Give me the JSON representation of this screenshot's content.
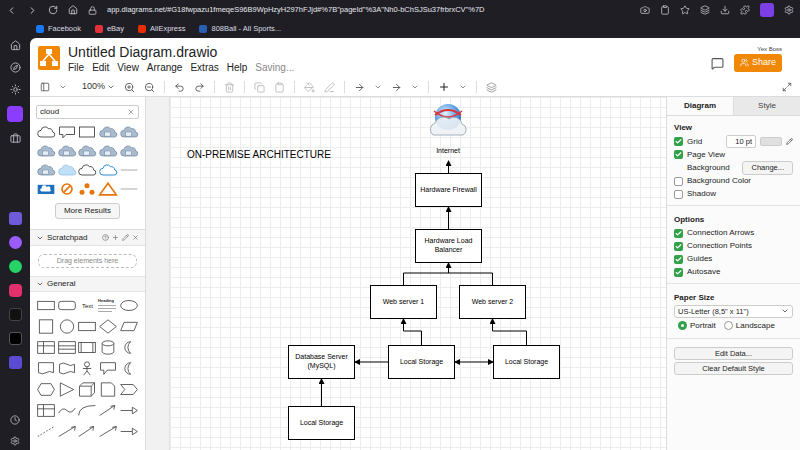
{
  "browser": {
    "url": "app.diagrams.net/#G18fwpazu1fmeqeS96B9WpHzyH297hFJjd#%7B\"pageId\"%3A\"Nh0-bChSJSu37frbrxCV\"%7D",
    "bookmarks": [
      {
        "label": "Facebook",
        "color": "#1877f2"
      },
      {
        "label": "eBay",
        "color": "#e53238"
      },
      {
        "label": "AliExpress",
        "color": "#e62e04"
      },
      {
        "label": "808Ball - All Sports...",
        "color": "#2b5fb4"
      }
    ]
  },
  "app": {
    "title": "Untitled Diagram.drawio",
    "menu": [
      "File",
      "Edit",
      "View",
      "Arrange",
      "Extras",
      "Help"
    ],
    "status": "Saving...",
    "user": "Yex Boss",
    "share": "Share"
  },
  "toolbar": {
    "zoom": "100%"
  },
  "shapes": {
    "search": "cloud",
    "results": [
      {
        "kind": "cloud-outline"
      },
      {
        "kind": "callout"
      },
      {
        "kind": "rect"
      },
      {
        "kind": "img"
      },
      {
        "kind": "img"
      },
      {
        "kind": "img"
      },
      {
        "kind": "img"
      },
      {
        "kind": "img"
      },
      {
        "kind": "img"
      },
      {
        "kind": "img"
      },
      {
        "kind": "img"
      },
      {
        "kind": "cloud-blue"
      },
      {
        "kind": "cloud-outline"
      },
      {
        "kind": "cloud-azure"
      },
      {
        "kind": "line"
      },
      {
        "kind": "flat-blue"
      },
      {
        "kind": "orange-circle"
      },
      {
        "kind": "orange-nodes"
      },
      {
        "kind": "orange-tri"
      },
      {
        "kind": "line"
      }
    ],
    "more": "More Results",
    "scratchpad": {
      "title": "Scratchpad",
      "expanded": true,
      "hint": "Drag elements here"
    },
    "general": {
      "title": "General",
      "expanded": true,
      "items": [
        {
          "kind": "rect",
          "label": ""
        },
        {
          "kind": "rounded",
          "label": ""
        },
        {
          "kind": "text",
          "label": "Text"
        },
        {
          "kind": "heading",
          "label": "Heading"
        },
        {
          "kind": "ellipse",
          "label": ""
        },
        {
          "kind": "square",
          "label": ""
        },
        {
          "kind": "circle",
          "label": ""
        },
        {
          "kind": "rect",
          "label": ""
        },
        {
          "kind": "diamond",
          "label": ""
        },
        {
          "kind": "parallelogram",
          "label": ""
        },
        {
          "kind": "table",
          "label": ""
        },
        {
          "kind": "lines",
          "label": ""
        },
        {
          "kind": "process",
          "label": ""
        },
        {
          "kind": "cylinder",
          "label": ""
        },
        {
          "kind": "moon",
          "label": ""
        },
        {
          "kind": "document",
          "label": ""
        },
        {
          "kind": "tape",
          "label": ""
        },
        {
          "kind": "actor",
          "label": ""
        },
        {
          "kind": "callout",
          "label": ""
        },
        {
          "kind": "moon",
          "label": ""
        },
        {
          "kind": "hexagon",
          "label": ""
        },
        {
          "kind": "triangle",
          "label": ""
        },
        {
          "kind": "cube",
          "label": ""
        },
        {
          "kind": "note",
          "label": ""
        },
        {
          "kind": "step",
          "label": ""
        },
        {
          "kind": "table",
          "label": ""
        },
        {
          "kind": "wave",
          "label": ""
        },
        {
          "kind": "curve",
          "label": ""
        },
        {
          "kind": "arrow",
          "label": ""
        },
        {
          "kind": "arrow2",
          "label": ""
        },
        {
          "kind": "line",
          "label": ""
        },
        {
          "kind": "line-arrow",
          "label": ""
        },
        {
          "kind": "arrow",
          "label": ""
        },
        {
          "kind": "line-arrow",
          "label": ""
        },
        {
          "kind": "arrow2",
          "label": ""
        }
      ]
    }
  },
  "diagram": {
    "title": "ON-PREMISE ARCHITECTURE",
    "nodes": [
      {
        "label": "Internet",
        "kind": "cloud"
      },
      {
        "label": "Hardware Firewall",
        "kind": "box"
      },
      {
        "label": "Hardware Load Balancer",
        "kind": "box"
      },
      {
        "label": "Web server 1",
        "kind": "box"
      },
      {
        "label": "Web server 2",
        "kind": "box"
      },
      {
        "label": "Database Server (MySQL)",
        "kind": "box"
      },
      {
        "label": "Local Storage",
        "kind": "box"
      },
      {
        "label": "Local Storage",
        "kind": "box"
      },
      {
        "label": "Local Storage",
        "kind": "box"
      }
    ]
  },
  "format": {
    "tabs": [
      {
        "label": "Diagram",
        "selected": true
      },
      {
        "label": "Style",
        "selected": false
      }
    ],
    "view_title": "View",
    "view": [
      {
        "kind": "grid",
        "label": "Grid",
        "checked": true,
        "value": "10 pt"
      },
      {
        "kind": "check",
        "label": "Page View",
        "checked": true
      },
      {
        "kind": "button",
        "label": "Background",
        "button": "Change..."
      },
      {
        "kind": "check",
        "label": "Background Color",
        "checked": false
      },
      {
        "kind": "check",
        "label": "Shadow",
        "checked": false
      }
    ],
    "options_title": "Options",
    "options": [
      {
        "label": "Connection Arrows",
        "checked": true
      },
      {
        "label": "Connection Points",
        "checked": true
      },
      {
        "label": "Guides",
        "checked": true
      },
      {
        "label": "Autosave",
        "checked": true
      }
    ],
    "paper_title": "Paper Size",
    "paper": "US-Letter (8,5\" x 11\")",
    "orientation": [
      {
        "label": "Portrait",
        "selected": true
      },
      {
        "label": "Landscape",
        "selected": false
      }
    ],
    "buttons": [
      "Edit Data...",
      "Clear Default Style"
    ]
  }
}
